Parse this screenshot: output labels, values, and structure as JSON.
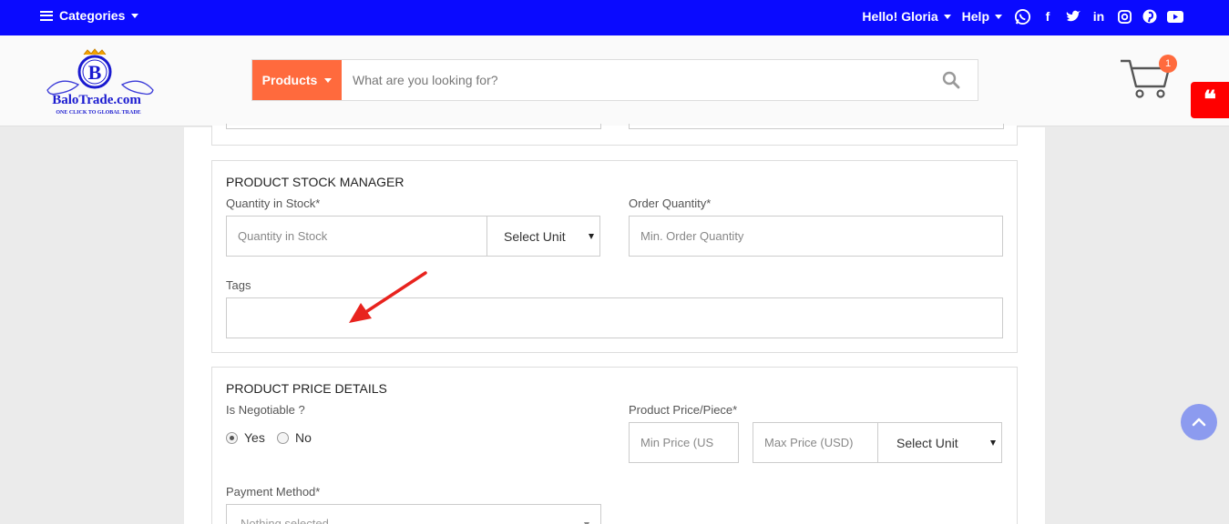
{
  "topbar": {
    "categories_label": "Categories",
    "greeting": "Hello! Gloria",
    "help_label": "Help",
    "social_icons": [
      "whatsapp-icon",
      "facebook-icon",
      "twitter-icon",
      "linkedin-icon",
      "instagram-icon",
      "pinterest-icon",
      "youtube-icon"
    ]
  },
  "header": {
    "logo_text": "BaloTrade.com",
    "logo_tagline": "ONE CLICK TO GLOBAL TRADE",
    "logo_letter": "B",
    "search_category": "Products",
    "search_placeholder": "What are you looking for?",
    "cart_count": "1"
  },
  "stock_section": {
    "title": "PRODUCT STOCK MANAGER",
    "quantity_label": "Quantity in Stock*",
    "quantity_placeholder": "Quantity in Stock",
    "unit_select": "Select Unit",
    "order_label": "Order Quantity*",
    "order_placeholder": "Min. Order Quantity",
    "tags_label": "Tags",
    "tags_value": ""
  },
  "price_section": {
    "title": "PRODUCT PRICE DETAILS",
    "negotiable_label": "Is Negotiable ?",
    "yes_label": "Yes",
    "no_label": "No",
    "negotiable_selected": "Yes",
    "price_label": "Product Price/Piece*",
    "min_price_placeholder": "Min Price (US",
    "max_price_placeholder": "Max Price (USD)",
    "unit_select": "Select Unit",
    "payment_label": "Payment Method*",
    "payment_value": "Nothing selected"
  },
  "colors": {
    "topbar": "#0a0aff",
    "accent": "#ff6a3d",
    "quote_tab": "#ff0000",
    "arrow": "#e8231e",
    "scroll_top": "#8c9bef"
  }
}
